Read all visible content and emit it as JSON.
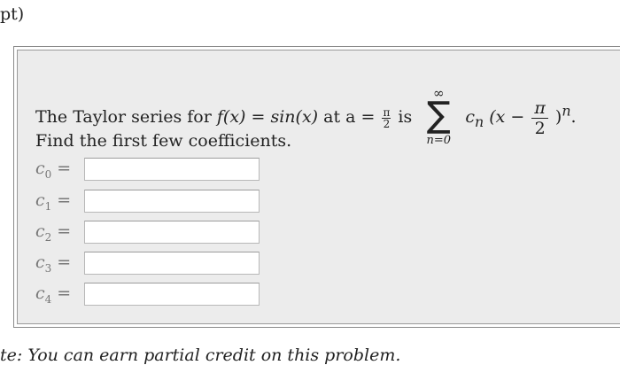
{
  "header": {
    "points_fragment": "pt)"
  },
  "problem": {
    "statement_prefix": "The Taylor series for",
    "function_text": "f(x) = sin(x)",
    "at_a": "at a =",
    "frac_num": "π",
    "frac_den": "2",
    "is_text": "is",
    "sum_upper": "∞",
    "sum_symbol": "∑",
    "sum_lower": "n=0",
    "series_term_prefix": "c",
    "series_term_sub": "n",
    "series_paren_open": "(x −",
    "series_frac_num": "π",
    "series_frac_den": "2",
    "series_paren_close": ")",
    "series_exponent": "n",
    "series_end": ".",
    "instruction": "Find the first few coefficients."
  },
  "coefficients": [
    {
      "var": "c",
      "sub": "0",
      "eq": "=",
      "value": ""
    },
    {
      "var": "c",
      "sub": "1",
      "eq": "=",
      "value": ""
    },
    {
      "var": "c",
      "sub": "2",
      "eq": "=",
      "value": ""
    },
    {
      "var": "c",
      "sub": "3",
      "eq": "=",
      "value": ""
    },
    {
      "var": "c",
      "sub": "4",
      "eq": "=",
      "value": ""
    }
  ],
  "footer": {
    "note": "te: You can earn partial credit on this problem."
  }
}
